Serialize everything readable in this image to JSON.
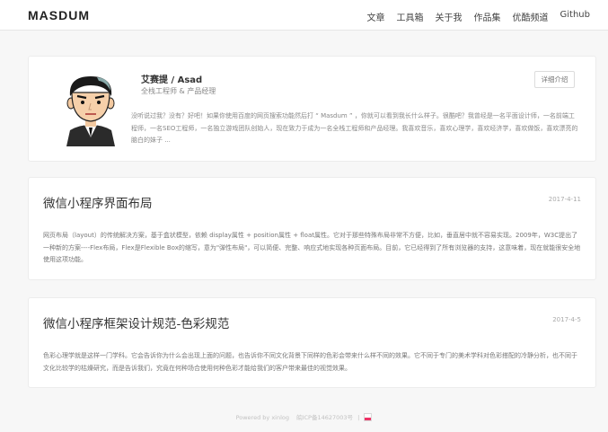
{
  "header": {
    "brand": "MASDUM",
    "nav": [
      "文章",
      "工具箱",
      "关于我",
      "作品集",
      "优酷频道",
      "Github"
    ]
  },
  "profile": {
    "name": "艾赛提 / Asad",
    "role": "全栈工程师 & 产品经理",
    "intro": "没听说过我？没有？好吧！如果你使用百度的网页搜索功能然后打 “ Masdum ” ，你就可以看到我长什么样子。很酷吧？我曾经是一名平面设计师，一名前端工程师，一名SEO工程师，一名独立游戏团队创始人，现在致力于成为一名全栈工程师和产品经理。我喜欢音乐，喜欢心理学，喜欢经济学，喜欢做饭，喜欢漂亮的脑白的妹子 ...",
    "detail_button": "详细介绍"
  },
  "posts": [
    {
      "title": "微信小程序界面布局",
      "date": "2017-4-11",
      "excerpt": "网页布局（layout）的传统解决方案，基于盒状模型，依赖 display属性 + position属性 + float属性。它对于那些特殊布局非常不方便，比如，垂直居中就不容易实现。2009年，W3C提出了一种新的方案----Flex布局，Flex是Flexible Box的缩写，意为\"弹性布局\"，可以简便、完整、响应式地实现各种页面布局。目前，它已经得到了所有浏览器的支持，这意味着，现在就能很安全地使用这项功能。"
    },
    {
      "title": "微信小程序框架设计规范-色彩规范",
      "date": "2017-4-5",
      "excerpt": "色彩心理学就是这样一门学科。它会告诉你为什么会出现上面的问题，也告诉你不同文化背景下同样的色彩会带来什么样不同的效果。它不同于专门的美术学科对色彩搭配的冷静分析，也不同于文化比较学的枯燥研究，而是告诉我们，究竟在何种场合使用何种色彩才能给我们的客户带来最佳的视觉效果。"
    }
  ],
  "footer": {
    "powered": "Powered by xinlog",
    "icp": "皖ICP备14627003号"
  }
}
